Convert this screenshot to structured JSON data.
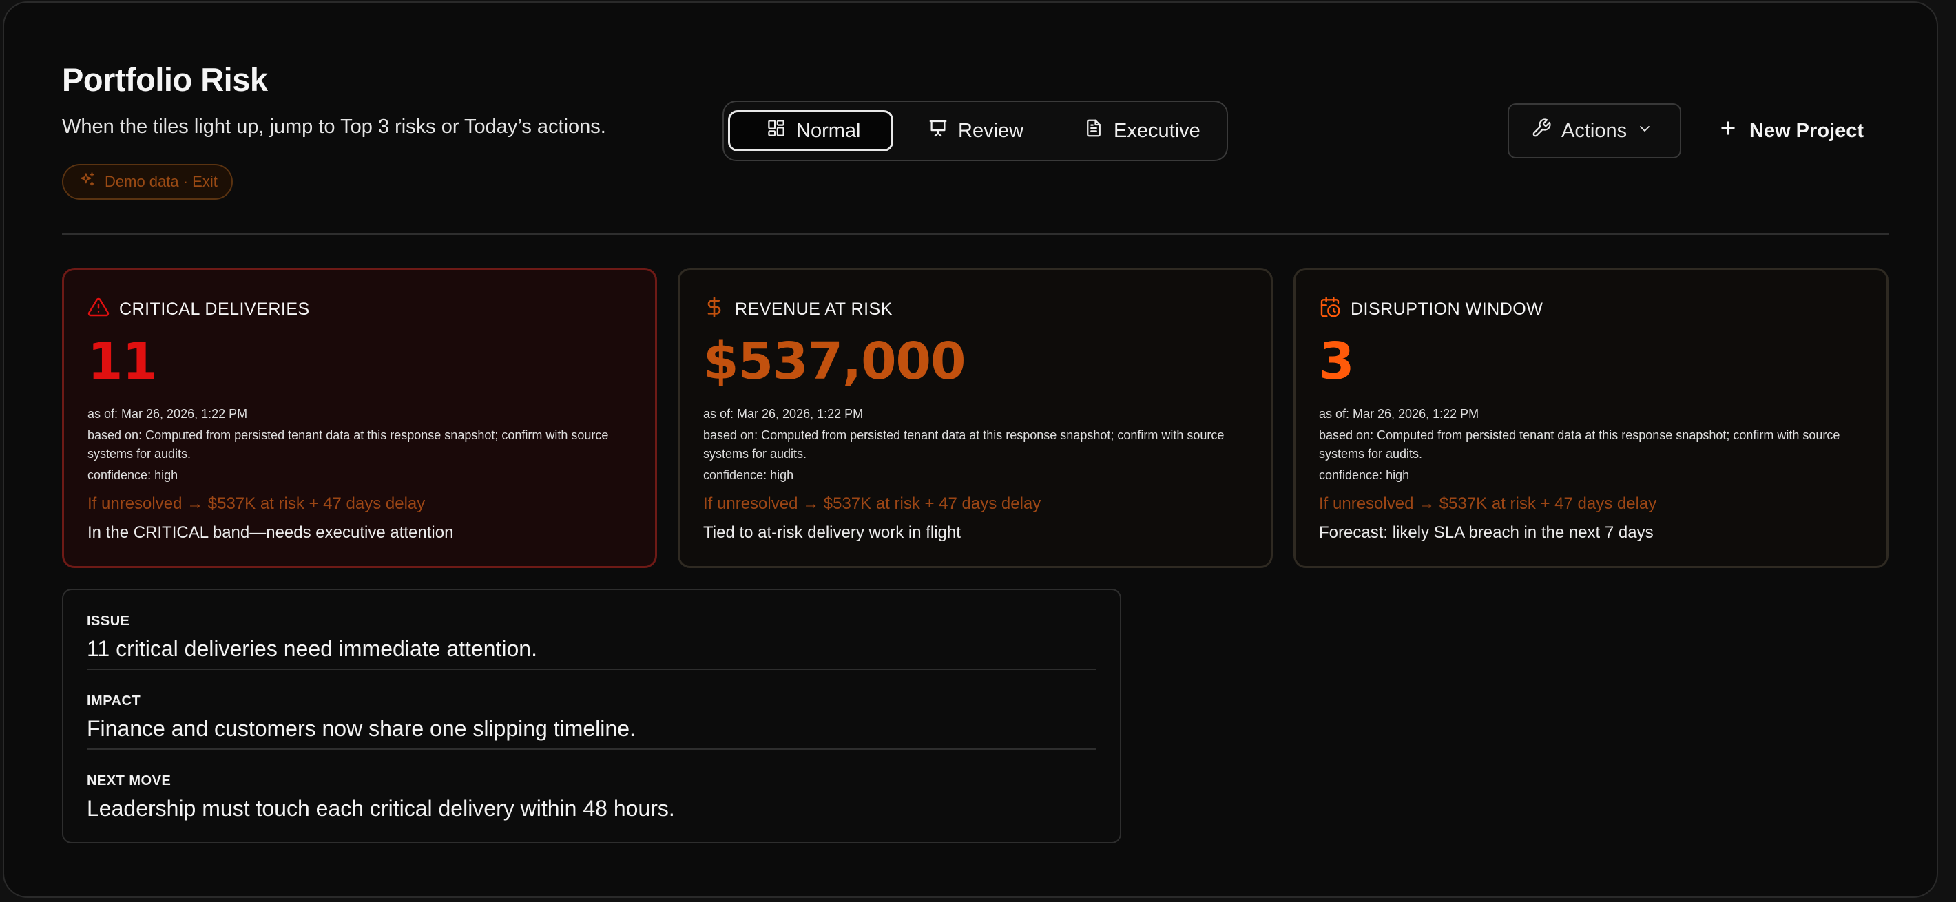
{
  "header": {
    "title": "Portfolio Risk",
    "subtitle": "When the tiles light up, jump to Top 3 risks or Today’s actions.",
    "demo_pill": "Demo data · Exit"
  },
  "view_modes": {
    "selected": "Normal",
    "options": [
      {
        "label": "Normal",
        "icon": "layout-grid-icon"
      },
      {
        "label": "Review",
        "icon": "presentation-icon"
      },
      {
        "label": "Executive",
        "icon": "document-icon"
      }
    ]
  },
  "toolbar": {
    "actions_label": "Actions",
    "new_project_label": "New Project"
  },
  "colors": {
    "critical": "#e01010",
    "revenue": "#c2510e",
    "disruption": "#ff5a0a",
    "unresolved": "#9c4615"
  },
  "cards": [
    {
      "title": "CRITICAL DELIVERIES",
      "icon": "alert-triangle-icon",
      "value": "11",
      "as_of": "as of: Mar 26, 2026, 1:22 PM",
      "based_on": "based on: Computed from persisted tenant data at this response snapshot; confirm with source systems for audits.",
      "confidence": "confidence: high",
      "unresolved": "If unresolved → $537K at risk + 47 days delay",
      "note": "In the CRITICAL band—needs executive attention"
    },
    {
      "title": "REVENUE AT RISK",
      "icon": "dollar-icon",
      "value": "$537,000",
      "as_of": "as of: Mar 26, 2026, 1:22 PM",
      "based_on": "based on: Computed from persisted tenant data at this response snapshot; confirm with source systems for audits.",
      "confidence": "confidence: high",
      "unresolved": "If unresolved → $537K at risk + 47 days delay",
      "note": "Tied to at-risk delivery work in flight"
    },
    {
      "title": "DISRUPTION WINDOW",
      "icon": "calendar-clock-icon",
      "value": "3",
      "as_of": "as of: Mar 26, 2026, 1:22 PM",
      "based_on": "based on: Computed from persisted tenant data at this response snapshot; confirm with source systems for audits.",
      "confidence": "confidence: high",
      "unresolved": "If unresolved → $537K at risk + 47 days delay",
      "note": "Forecast: likely SLA breach in the next 7 days"
    }
  ],
  "summary": [
    {
      "label": "ISSUE",
      "text": "11 critical deliveries need immediate attention."
    },
    {
      "label": "IMPACT",
      "text": "Finance and customers now share one slipping timeline."
    },
    {
      "label": "NEXT MOVE",
      "text": "Leadership must touch each critical delivery within 48 hours."
    }
  ]
}
